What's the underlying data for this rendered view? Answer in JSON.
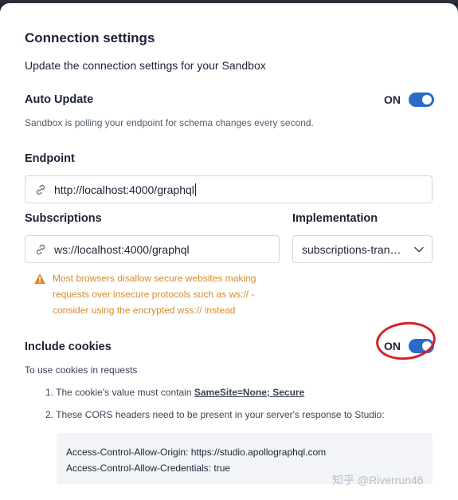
{
  "dialog": {
    "title": "Connection settings",
    "subtitle": "Update the connection settings for your Sandbox"
  },
  "auto_update": {
    "heading": "Auto Update",
    "toggle_label": "ON",
    "toggle_on": true,
    "help": "Sandbox is polling your endpoint for schema changes every second."
  },
  "endpoint": {
    "heading": "Endpoint",
    "value": "http://localhost:4000/graphql",
    "icon": "link-icon"
  },
  "subscriptions": {
    "heading": "Subscriptions",
    "value": "ws://localhost:4000/graphql",
    "icon": "link-icon",
    "warning": "Most browsers disallow secure websites making requests over insecure protocols such as ws:// - consider using the encrypted wss:// instead"
  },
  "implementation": {
    "heading": "Implementation",
    "selected": "subscriptions-tran…"
  },
  "include_cookies": {
    "heading": "Include cookies",
    "toggle_label": "ON",
    "toggle_on": true,
    "help": "To use cookies in requests",
    "step1_prefix": "1. The cookie's value must contain ",
    "step1_bold": "SameSite=None; Secure",
    "step2": "2. These CORS headers need to be present in your server's response to Studio:",
    "header_line1": "Access-Control-Allow-Origin: https://studio.apollographql.com",
    "header_line2": "Access-Control-Allow-Credentials: true"
  },
  "watermark": "知乎 @Riverrun46",
  "colors": {
    "accent": "#2a6bc9",
    "warning": "#d68a2e",
    "annotation": "#d8202a"
  }
}
